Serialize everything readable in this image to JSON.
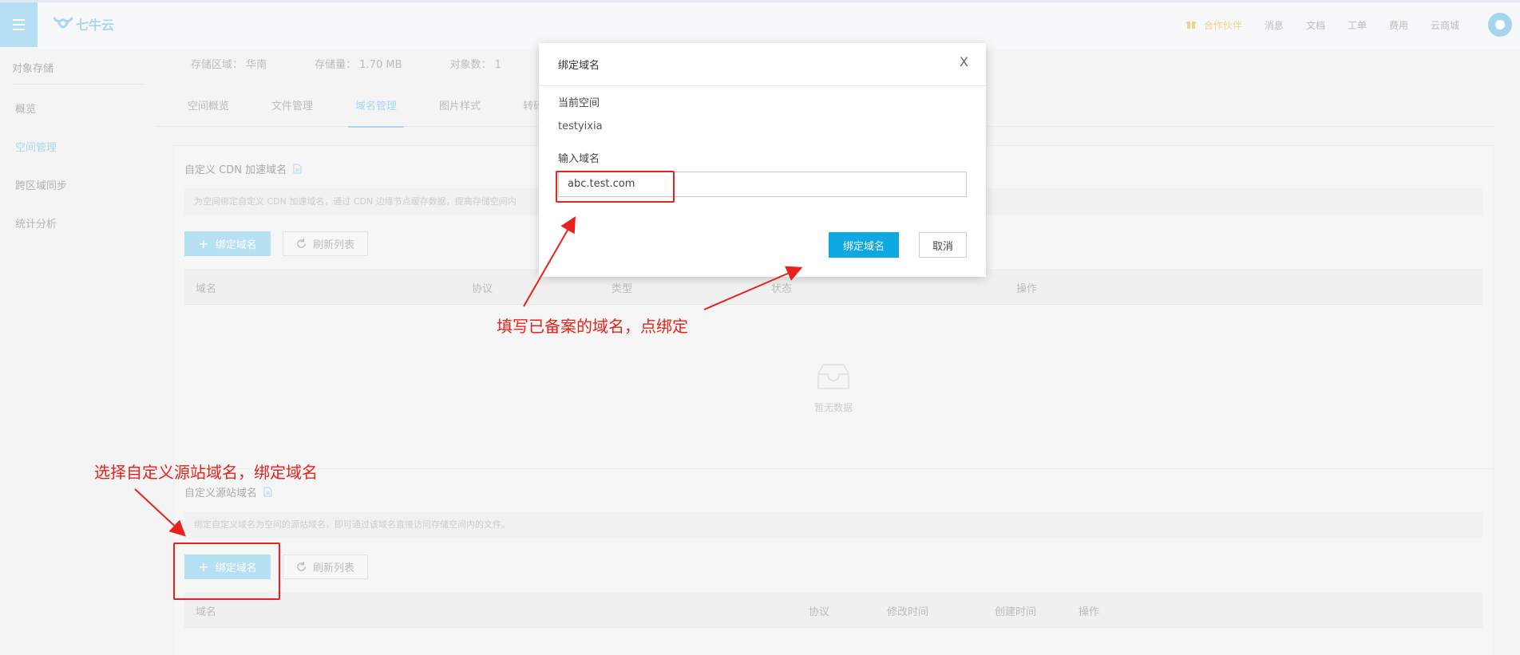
{
  "topbar": {
    "logo_text": "七牛云",
    "nav": [
      "合作伙伴",
      "消息",
      "文档",
      "工单",
      "费用",
      "云商城"
    ]
  },
  "sidebar": {
    "section_title": "对象存储",
    "items": [
      {
        "label": "概览"
      },
      {
        "label": "空间管理"
      },
      {
        "label": "跨区域同步"
      },
      {
        "label": "统计分析"
      }
    ]
  },
  "info": {
    "region": "存储区域： 华南",
    "storage": "存储量： 1.70 MB",
    "objects": "对象数： 1"
  },
  "tabs": [
    "空间概览",
    "文件管理",
    "域名管理",
    "图片样式",
    "转码"
  ],
  "cdn_section": {
    "title": "自定义 CDN 加速域名",
    "description": "为空间绑定自定义 CDN 加速域名，通过 CDN 边缘节点缓存数据，提高存储空间内",
    "bind_label": "绑定域名",
    "refresh_label": "刷新列表",
    "columns": [
      "域名",
      "协议",
      "类型",
      "状态",
      "操作"
    ],
    "empty_text": "暂无数据"
  },
  "origin_section": {
    "title": "自定义源站域名",
    "description": "绑定自定义域名为空间的源站域名，即可通过该域名直接访问存储空间内的文件。",
    "bind_label": "绑定域名",
    "refresh_label": "刷新列表",
    "columns": [
      "域名",
      "协议",
      "修改时间",
      "创建时间",
      "操作"
    ]
  },
  "modal": {
    "title": "绑定域名",
    "close": "X",
    "current_space_label": "当前空间",
    "current_space_value": "testyixia",
    "domain_label": "输入域名",
    "domain_value": "abc.test.com",
    "confirm_label": "绑定域名",
    "cancel_label": "取消"
  },
  "annotations": {
    "fill_in": "填写已备案的域名，点绑定",
    "select_origin": "选择自定义源站域名，绑定域名",
    "color": "#e8211c"
  }
}
